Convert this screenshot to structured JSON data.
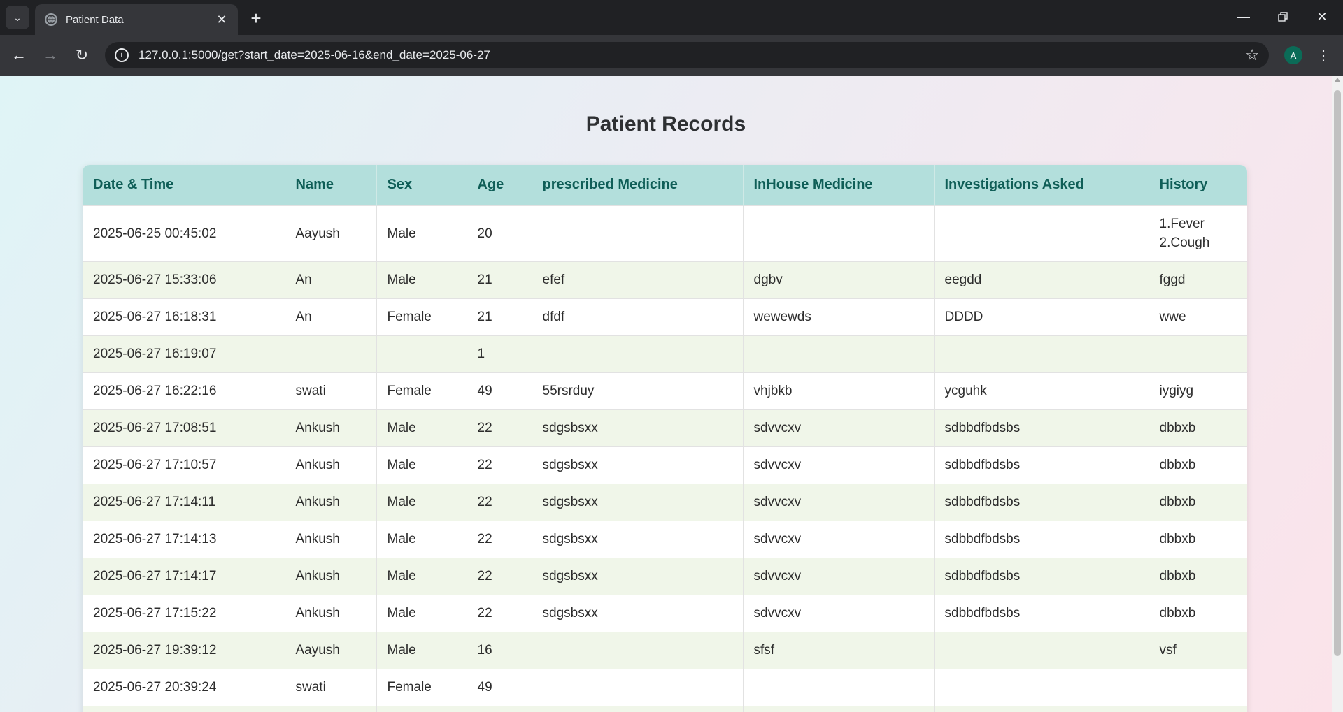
{
  "browser": {
    "tab_title": "Patient Data",
    "url": "127.0.0.1:5000/get?start_date=2025-06-16&end_date=2025-06-27",
    "profile_initial": "A"
  },
  "page": {
    "title": "Patient Records"
  },
  "table": {
    "headers": [
      "Date & Time",
      "Name",
      "Sex",
      "Age",
      "prescribed Medicine",
      "InHouse Medicine",
      "Investigations Asked",
      "History"
    ],
    "rows": [
      [
        "2025-06-25 00:45:02",
        "Aayush",
        "Male",
        "20",
        "",
        "",
        "",
        "1.Fever\n2.Cough"
      ],
      [
        "2025-06-27 15:33:06",
        "An",
        "Male",
        "21",
        "efef",
        "dgbv",
        "eegdd",
        "fggd"
      ],
      [
        "2025-06-27 16:18:31",
        "An",
        "Female",
        "21",
        "dfdf",
        "wewewds",
        "DDDD",
        "wwe"
      ],
      [
        "2025-06-27 16:19:07",
        "",
        "",
        "1",
        "",
        "",
        "",
        ""
      ],
      [
        "2025-06-27 16:22:16",
        "swati",
        "Female",
        "49",
        "55rsrduy",
        "vhjbkb",
        "ycguhk",
        "iygiyg"
      ],
      [
        "2025-06-27 17:08:51",
        "Ankush",
        "Male",
        "22",
        "sdgsbsxx",
        "sdvvcxv",
        "sdbbdfbdsbs",
        "dbbxb"
      ],
      [
        "2025-06-27 17:10:57",
        "Ankush",
        "Male",
        "22",
        "sdgsbsxx",
        "sdvvcxv",
        "sdbbdfbdsbs",
        "dbbxb"
      ],
      [
        "2025-06-27 17:14:11",
        "Ankush",
        "Male",
        "22",
        "sdgsbsxx",
        "sdvvcxv",
        "sdbbdfbdsbs",
        "dbbxb"
      ],
      [
        "2025-06-27 17:14:13",
        "Ankush",
        "Male",
        "22",
        "sdgsbsxx",
        "sdvvcxv",
        "sdbbdfbdsbs",
        "dbbxb"
      ],
      [
        "2025-06-27 17:14:17",
        "Ankush",
        "Male",
        "22",
        "sdgsbsxx",
        "sdvvcxv",
        "sdbbdfbdsbs",
        "dbbxb"
      ],
      [
        "2025-06-27 17:15:22",
        "Ankush",
        "Male",
        "22",
        "sdgsbsxx",
        "sdvvcxv",
        "sdbbdfbdsbs",
        "dbbxb"
      ],
      [
        "2025-06-27 19:39:12",
        "Aayush",
        "Male",
        "16",
        "",
        "sfsf",
        "",
        "vsf"
      ],
      [
        "2025-06-27 20:39:24",
        "swati",
        "Female",
        "49",
        "",
        "",
        "",
        ""
      ],
      [
        "",
        "",
        "",
        "",
        "",
        "",
        "",
        ""
      ]
    ]
  }
}
